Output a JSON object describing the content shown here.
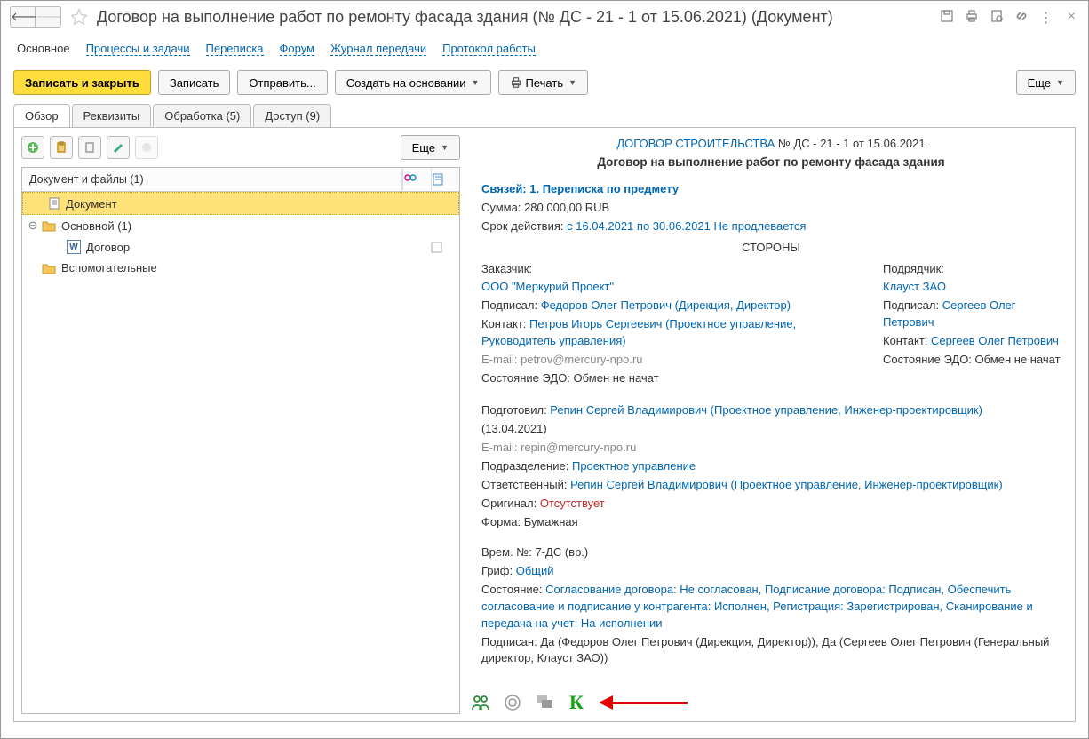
{
  "title": "Договор  на  выполнение работ по ремонту фасада здания (№ ДС - 21 - 1 от 15.06.2021) (Документ)",
  "topnav": {
    "main": "Основное",
    "processes": "Процессы и задачи",
    "correspondence": "Переписка",
    "forum": "Форум",
    "transfer_log": "Журнал передачи",
    "work_log": "Протокол работы"
  },
  "toolbar": {
    "save_close": "Записать и закрыть",
    "save": "Записать",
    "send": "Отправить...",
    "create_based": "Создать на основании",
    "print": "Печать",
    "more": "Еще"
  },
  "sectabs": {
    "overview": "Обзор",
    "requisites": "Реквизиты",
    "processing": "Обработка (5)",
    "access": "Доступ (9)"
  },
  "left": {
    "more": "Еще",
    "tree_header": "Документ и файлы (1)",
    "row_doc": "Документ",
    "row_main": "Основной (1)",
    "row_contract": "Договор",
    "row_aux": "Вспомогательные"
  },
  "right": {
    "header_link": "ДОГОВОР СТРОИТЕЛЬСТВА",
    "header_num": " № ДС - 21 - 1 от 15.06.2021",
    "subtitle": "Договор на выполнение работ по ремонту фасада здания",
    "links_label": "Связей: 1. Переписка по предмету",
    "sum_label": "Сумма:",
    "sum_value": " 280 000,00 RUB",
    "validity_label": "Срок действия:",
    "validity_value": " с 16.04.2021 по 30.06.2021 Не продлевается",
    "parties_title": "СТОРОНЫ",
    "customer": {
      "role": "Заказчик:",
      "name": "ООО \"Меркурий Проект\"",
      "signed_label": "Подписал:",
      "signed_value": " Федоров Олег Петрович (Дирекция, Директор)",
      "contact_label": "Контакт:",
      "contact_value": " Петров Игорь Сергеевич (Проектное управление, Руководитель управления)",
      "email_label": "E-mail:",
      "email_value": " petrov@mercury-npo.ru",
      "edo_label": "Состояние ЭДО:",
      "edo_value": " Обмен не начат"
    },
    "contractor": {
      "role": "Подрядчик:",
      "name": "Клауст ЗАО",
      "signed_label": "Подписал:",
      "signed_value": " Сергеев Олег Петрович",
      "contact_label": "Контакт:",
      "contact_value": " Сергеев Олег Петрович",
      "edo_label": "Состояние ЭДО:",
      "edo_value": " Обмен не начат"
    },
    "prepared_label": "Подготовил:",
    "prepared_value": " Репин Сергей Владимирович (Проектное управление, Инженер-проектировщик)",
    "prepared_date": "(13.04.2021)",
    "prepared_email_label": "E-mail:",
    "prepared_email_value": " repin@mercury-npo.ru",
    "dept_label": "Подразделение:",
    "dept_value": " Проектное управление",
    "resp_label": "Ответственный:",
    "resp_value": " Репин Сергей Владимирович (Проектное управление, Инженер-проектировщик)",
    "orig_label": "Оригинал:",
    "orig_value": " Отсутствует",
    "form_label": "Форма:",
    "form_value": " Бумажная",
    "temp_label": "Врем. №:",
    "temp_value": " 7-ДС (вр.)",
    "grif_label": "Гриф:",
    "grif_value": " Общий",
    "state_label": "Состояние:",
    "state_value": " Согласование договора: Не согласован, Подписание договора: Подписан, Обеспечить согласование и подписание у контрагента: Исполнен, Регистрация: Зарегистрирован, Сканирование и передача на учет: На исполнении",
    "signed2_label": "Подписан:",
    "signed2_value": " Да (Федоров Олег Петрович (Дирекция, Директор)), Да (Сергеев Олег Петрович (Генеральный директор, Клауст ЗАО))"
  }
}
